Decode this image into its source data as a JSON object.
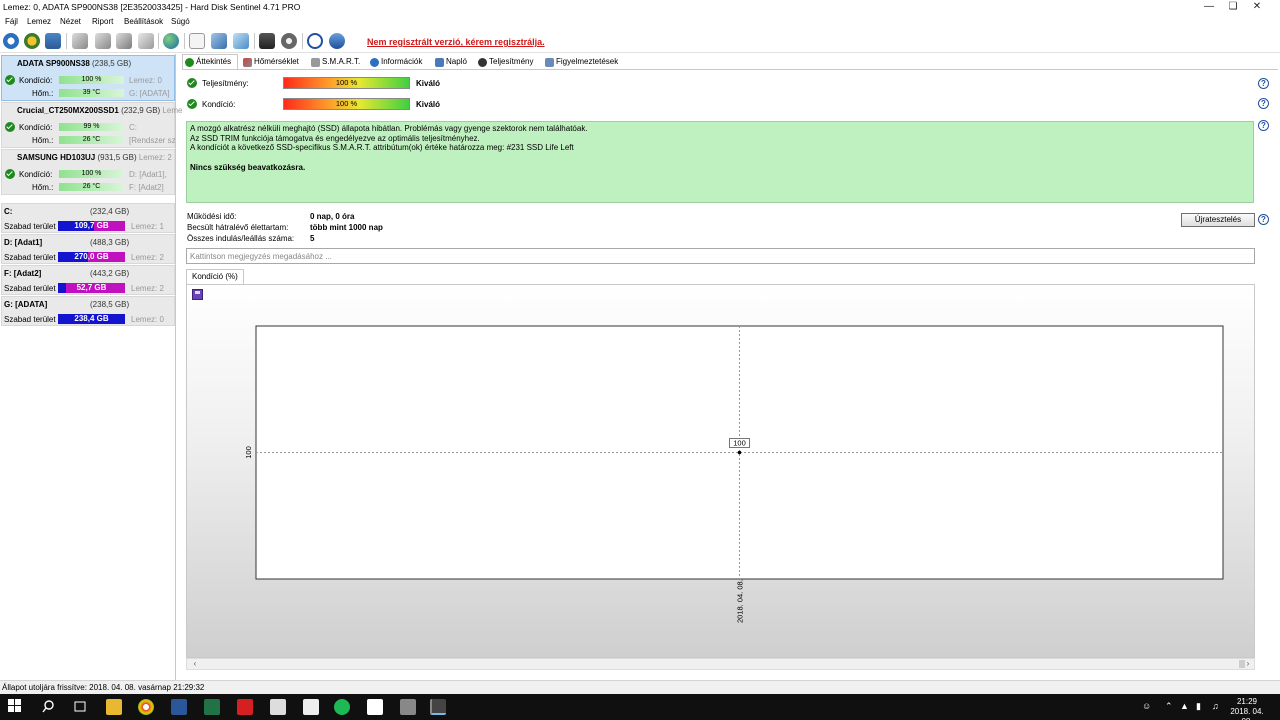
{
  "window": {
    "title": "Lemez: 0, ADATA SP900NS38 [2E3520033425]  -  Hard Disk Sentinel 4.71 PRO"
  },
  "menu": [
    "Fájl",
    "Lemez",
    "Nézet",
    "Riport",
    "Beállítások",
    "Súgó"
  ],
  "registration_warning": "Nem regisztrált verzió, kérem regisztrálja.",
  "disks": [
    {
      "name": "ADATA SP900NS38",
      "size": "(238,5 GB)",
      "extra": "",
      "condition_label": "Kondíció:",
      "condition_value": "100 %",
      "condition_pct": 100,
      "temp_label": "Hőm.:",
      "temp_value": "39 °C",
      "meta1": "Lemez: 0",
      "meta2": "G: [ADATA]",
      "selected": true
    },
    {
      "name": "Crucial_CT250MX200SSD1",
      "size": "(232,9 GB)",
      "extra": "Lemez",
      "condition_label": "Kondíció:",
      "condition_value": "99 %",
      "condition_pct": 99,
      "temp_label": "Hőm.:",
      "temp_value": "26 °C",
      "meta1": "C:",
      "meta2": "[Rendszer sz",
      "selected": false
    },
    {
      "name": "SAMSUNG HD103UJ",
      "size": "(931,5 GB)",
      "extra": "Lemez: 2",
      "condition_label": "Kondíció:",
      "condition_value": "100 %",
      "condition_pct": 100,
      "temp_label": "Hőm.:",
      "temp_value": "26 °C",
      "meta1": "D: [Adat1],",
      "meta2": "F: [Adat2]",
      "selected": false
    }
  ],
  "partitions": [
    {
      "name": "C:",
      "size": "(232,4 GB)",
      "free_label": "Szabad terület",
      "free_value": "109,7 GB",
      "free_fraction": 0.47,
      "disk": "Lemez: 1"
    },
    {
      "name": "D: [Adat1]",
      "size": "(488,3 GB)",
      "free_label": "Szabad terület",
      "free_value": "270,0 GB",
      "free_fraction": 0.55,
      "disk": "Lemez: 2"
    },
    {
      "name": "F: [Adat2]",
      "size": "(443,2 GB)",
      "free_label": "Szabad terület",
      "free_value": "52,7 GB",
      "free_fraction": 0.88,
      "disk": "Lemez: 2"
    },
    {
      "name": "G: [ADATA]",
      "size": "(238,5 GB)",
      "free_label": "Szabad terület",
      "free_value": "238,4 GB",
      "free_fraction": 0.0,
      "disk": "Lemez: 0"
    }
  ],
  "tabs": [
    "Áttekintés",
    "Hőmérséklet",
    "S.M.A.R.T.",
    "Információk",
    "Napló",
    "Teljesítmény",
    "Figyelmeztetések"
  ],
  "overview": {
    "performance_label": "Teljesítmény:",
    "performance_value": "100 %",
    "performance_rating": "Kiváló",
    "condition_label": "Kondíció:",
    "condition_value": "100 %",
    "condition_rating": "Kiváló",
    "message_lines": [
      "A mozgó alkatrész nélküli meghajtó (SSD) állapota hibátlan. Problémás vagy gyenge szektorok nem találhatóak.",
      "Az SSD TRIM funkciója támogatva és engedélyezve az optimális teljesítményhez.",
      "A kondíciót a következő SSD-specifikus S.M.A.R.T. attribútum(ok) értéke határozza meg:  #231 SSD Life Left"
    ],
    "message_bold": "Nincs szükség beavatkozásra.",
    "uptime_label": "Működési idő:",
    "uptime_value": "0 nap, 0 óra",
    "lifetime_label": "Becsült hátralévő élettartam:",
    "lifetime_value": "több mint 1000 nap",
    "startups_label": "Összes indulás/leállás száma:",
    "startups_value": "5",
    "retest_button": "Újratesztelés",
    "note_placeholder": "Kattintson megjegyzés megadásához ..."
  },
  "chart_tab": "Kondíció  (%)",
  "chart_data": {
    "type": "line",
    "x": [
      "2018. 04. 08."
    ],
    "values": [
      100
    ],
    "point_labels": [
      "100"
    ],
    "y_tick_labels": [
      "100"
    ],
    "x_tick_labels": [
      "2018. 04. 08."
    ]
  },
  "statusbar": "Állapot utoljára frissítve: 2018. 04. 08. vasárnap 21:29:32",
  "taskbar": {
    "time": "21:29",
    "date": "2018. 04. 08."
  }
}
